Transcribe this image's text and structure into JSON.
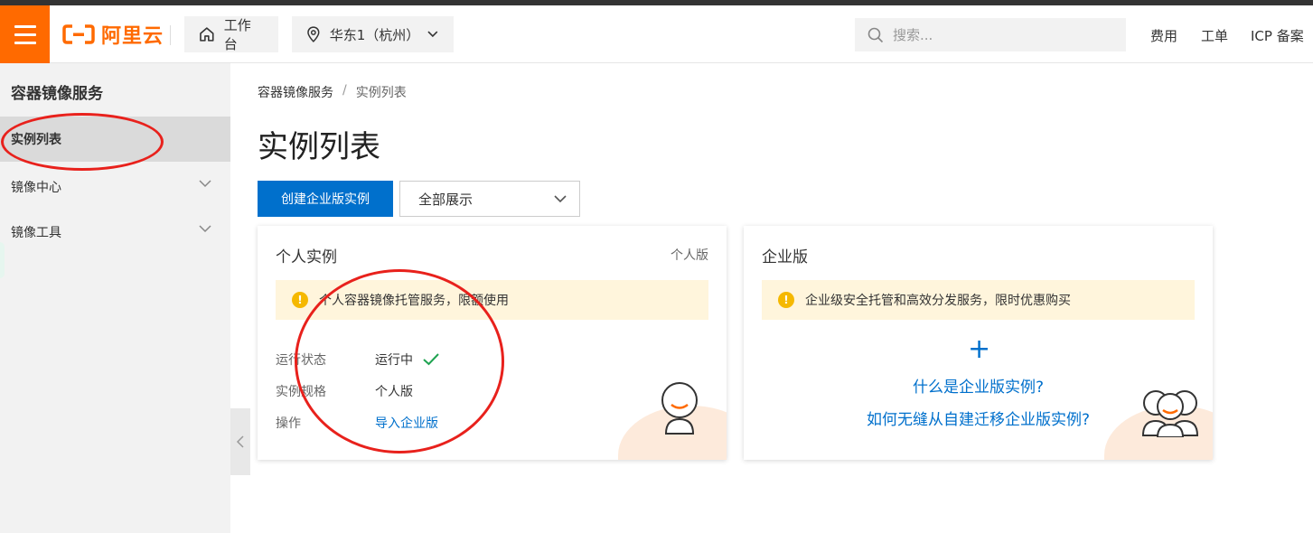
{
  "header": {
    "logo_text": "阿里云",
    "workbench_label": "工作台",
    "region_label": "华东1（杭州）",
    "search_placeholder": "搜索...",
    "links": [
      "费用",
      "工单",
      "ICP 备案"
    ]
  },
  "sidebar": {
    "title": "容器镜像服务",
    "items": [
      {
        "label": "实例列表",
        "active": true
      },
      {
        "label": "镜像中心",
        "expandable": true
      },
      {
        "label": "镜像工具",
        "expandable": true
      }
    ]
  },
  "breadcrumb": [
    "容器镜像服务",
    "实例列表"
  ],
  "page_title": "实例列表",
  "toolbar": {
    "create_button": "创建企业版实例",
    "filter_value": "全部展示"
  },
  "personal_card": {
    "title": "个人实例",
    "tag": "个人版",
    "notice": "个人容器镜像托管服务，限额使用",
    "rows": [
      {
        "label": "运行状态",
        "value": "运行中"
      },
      {
        "label": "实例规格",
        "value": "个人版"
      },
      {
        "label": "操作",
        "value": "导入企业版"
      }
    ]
  },
  "enterprise_card": {
    "title": "企业版",
    "notice": "企业级安全托管和高效分发服务，限时优惠购买",
    "link1": "什么是企业版实例?",
    "link2": "如何无缝从自建迁移企业版实例?"
  },
  "colors": {
    "brand": "#ff6a00",
    "primary": "#0070cc",
    "annotation": "#e8211c",
    "success": "#1fa351"
  }
}
